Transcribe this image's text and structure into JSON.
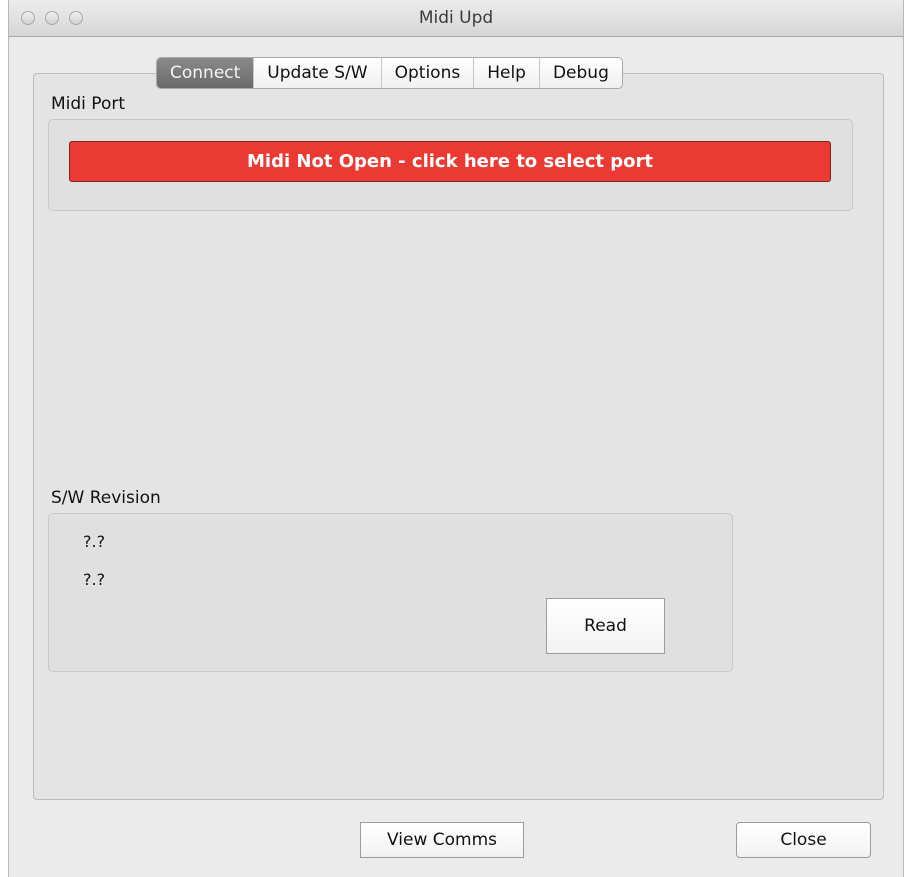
{
  "window": {
    "title": "Midi  Upd"
  },
  "tabs": [
    {
      "label": "Connect",
      "active": true
    },
    {
      "label": "Update S/W",
      "active": false
    },
    {
      "label": "Options",
      "active": false
    },
    {
      "label": "Help",
      "active": false
    },
    {
      "label": "Debug",
      "active": false
    }
  ],
  "midi_port": {
    "label": "Midi Port",
    "button_label": "Midi Not Open - click here to select port",
    "button_color": "#ea3a33"
  },
  "sw_revision": {
    "label": "S/W Revision",
    "value_1": "?.?",
    "value_2": "?.?",
    "read_label": "Read"
  },
  "footer": {
    "view_comms_label": "View Comms",
    "close_label": "Close"
  }
}
